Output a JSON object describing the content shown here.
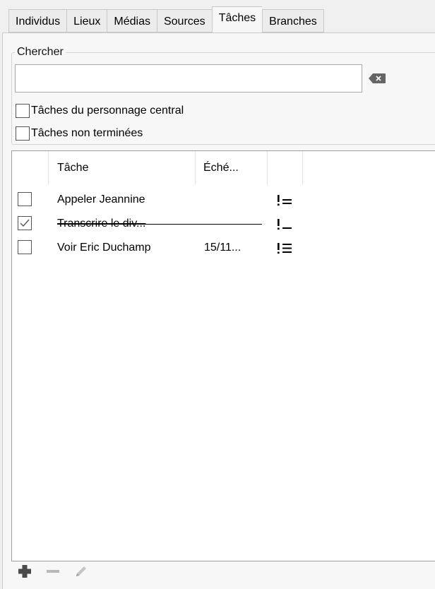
{
  "tabs": [
    {
      "label": "Individus"
    },
    {
      "label": "Lieux"
    },
    {
      "label": "Médias"
    },
    {
      "label": "Sources"
    },
    {
      "label": "Tâches"
    },
    {
      "label": "Branches"
    }
  ],
  "active_tab": "Tâches",
  "search": {
    "legend": "Chercher",
    "value": "",
    "placeholder": "",
    "filters": [
      {
        "label": "Tâches du personnage central",
        "checked": false
      },
      {
        "label": "Tâches non terminées",
        "checked": false
      }
    ]
  },
  "table": {
    "columns": [
      "Tâche",
      "Éché...",
      ""
    ],
    "rows": [
      {
        "done": false,
        "title": "Appeler Jeannine",
        "due": "",
        "priority_icon": "priority-medium-icon"
      },
      {
        "done": true,
        "title": "Transcrire le div...",
        "due": "",
        "priority_icon": "priority-low-icon"
      },
      {
        "done": false,
        "title": "Voir Eric Duchamp",
        "due": "15/11...",
        "priority_icon": "priority-high-icon"
      }
    ]
  },
  "toolbar": {
    "add_icon": "add-icon",
    "remove_icon": "remove-icon",
    "edit_icon": "edit-pencil-icon"
  },
  "colors": {
    "accent": "#8a8a8a",
    "border": "#c9c9c9"
  }
}
